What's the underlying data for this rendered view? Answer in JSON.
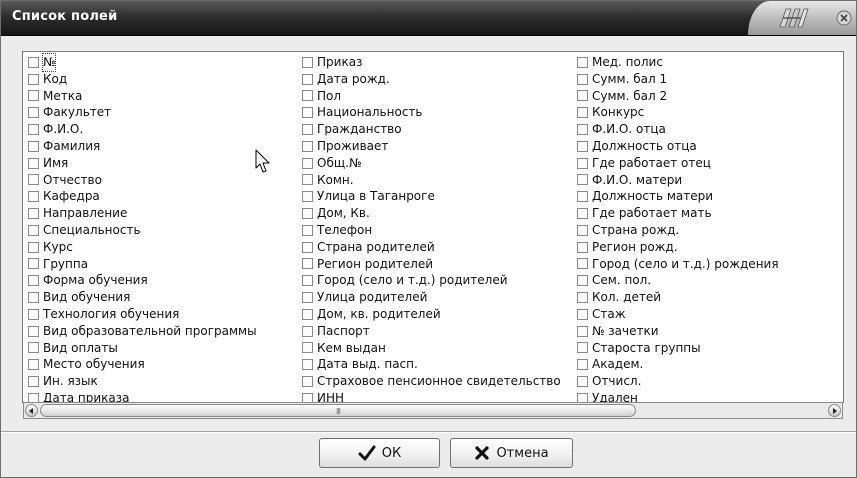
{
  "window": {
    "title": "Список полей"
  },
  "fields": {
    "columns": [
      [
        "№",
        "Код",
        "Метка",
        "Факультет",
        "Ф.И.О.",
        "Фамилия",
        "Имя",
        "Отчество",
        "Кафедра",
        "Направление",
        "Специальность",
        "Курс",
        "Группа",
        "Форма обучения",
        "Вид обучения",
        "Технология обучения",
        "Вид образовательной программы",
        "Вид оплаты",
        "Место обучения",
        "Ин. язык",
        "Дата приказа"
      ],
      [
        "Приказ",
        "Дата рожд.",
        "Пол",
        "Национальность",
        "Гражданство",
        "Проживает",
        "Общ.№",
        "Комн.",
        "Улица в Таганроге",
        "Дом, Кв.",
        "Телефон",
        "Страна родителей",
        "Регион родителей",
        "Город (село и т.д.) родителей",
        "Улица родителей",
        "Дом, кв. родителей",
        "Паспорт",
        "Кем выдан",
        "Дата выд. пасп.",
        "Страховое пенсионное свидетельство",
        "ИНН"
      ],
      [
        "Мед. полис",
        "Сумм. бал 1",
        "Сумм. бал 2",
        "Конкурс",
        "Ф.И.О. отца",
        "Должность отца",
        "Где работает отец",
        "Ф.И.О. матери",
        "Должность матери",
        "Где работает мать",
        "Страна рожд.",
        "Регион рожд.",
        "Город (село и т.д.) рождения",
        "Сем. пол.",
        "Кол. детей",
        "Стаж",
        "№ зачетки",
        "Староста группы",
        "Академ.",
        "Отчисл.",
        "Удален"
      ]
    ],
    "focused_item": "№"
  },
  "scrollbar": {
    "grip": "III"
  },
  "buttons": {
    "ok_label": "ОК",
    "cancel_label": "Отмена"
  },
  "icons": {
    "ok": "checkmark-icon",
    "cancel": "cross-icon",
    "close": "close-icon",
    "logo": "app-logo-icon",
    "cursor": "mouse-pointer-icon"
  }
}
